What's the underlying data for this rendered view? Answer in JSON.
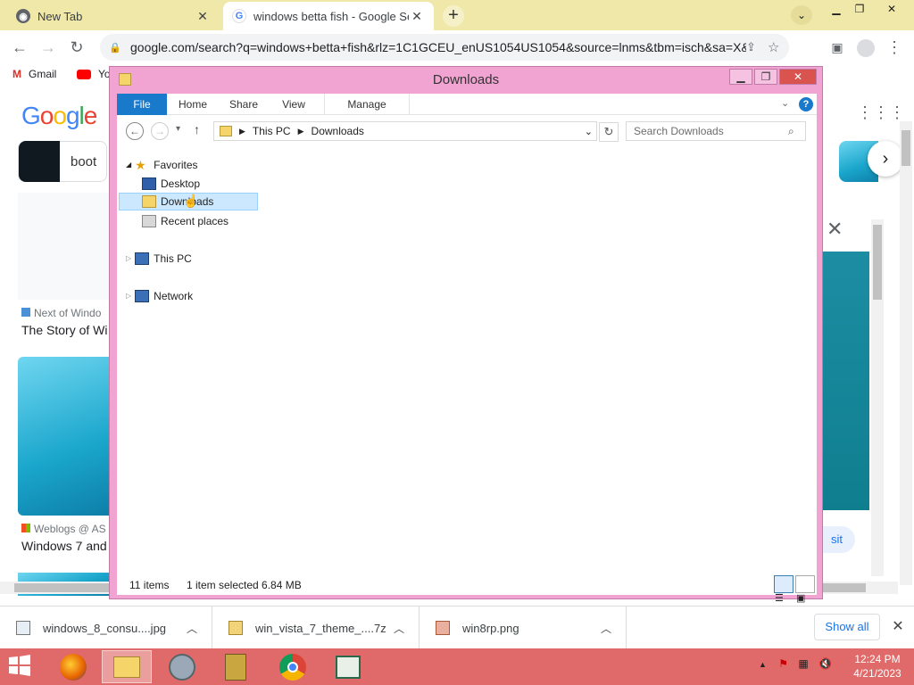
{
  "browser": {
    "tabs": [
      {
        "title": "New Tab",
        "active": false
      },
      {
        "title": "windows betta fish - Google Sea",
        "active": true
      }
    ],
    "url": "google.com/search?q=windows+betta+fish&rlz=1C1GCEU_enUS1054US1054&source=lnms&tbm=isch&sa=X&...",
    "bookmarks": [
      {
        "label": "Gmail"
      },
      {
        "label": "Yo"
      }
    ]
  },
  "page": {
    "logo": "Google",
    "pill_label": "boot",
    "results": [
      {
        "source": "Next of Windo",
        "title": "The Story of Wi"
      },
      {
        "source": "Weblogs @ AS",
        "title": "Windows 7 and"
      }
    ],
    "visit_label": "sit"
  },
  "explorer": {
    "title": "Downloads",
    "ribbon_tabs": [
      "File",
      "Home",
      "Share",
      "View",
      "Manage"
    ],
    "breadcrumb": [
      "This PC",
      "Downloads"
    ],
    "search_placeholder": "Search Downloads",
    "nav": {
      "favorites_label": "Favorites",
      "favorites": [
        "Desktop",
        "Downloads",
        "Recent places"
      ],
      "this_pc": "This PC",
      "network": "Network"
    },
    "status": {
      "items": "11 items",
      "selected": "1 item selected  6.84 MB"
    }
  },
  "downloads": {
    "items": [
      {
        "name": "windows_8_consu....jpg"
      },
      {
        "name": "win_vista_7_theme_....7z"
      },
      {
        "name": "win8rp.png"
      }
    ],
    "show_all": "Show all"
  },
  "taskbar": {
    "time": "12:24 PM",
    "date": "4/21/2023"
  },
  "colors": {
    "chrome_tabstrip": "#f0e8a8",
    "explorer_frame": "#f1a3d2",
    "taskbar": "#e06a6a",
    "file_tab": "#1979ca"
  }
}
